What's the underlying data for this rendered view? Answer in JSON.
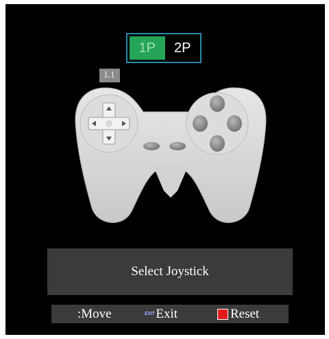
{
  "player_tabs": [
    {
      "label": "1P",
      "active": true
    },
    {
      "label": "2P",
      "active": false
    }
  ],
  "l1_label": "L1",
  "info_panel": {
    "text": "Select Joystick"
  },
  "hint_bar": {
    "move_label": ":Move",
    "exit_icon_text": "EXIT",
    "exit_label": "Exit",
    "reset_label": "Reset"
  },
  "colors": {
    "active_tab": "#26a45a",
    "tab_border": "#2a8aa8",
    "panel_bg": "#3b3b3b",
    "reset_icon": "#e11b1b"
  }
}
